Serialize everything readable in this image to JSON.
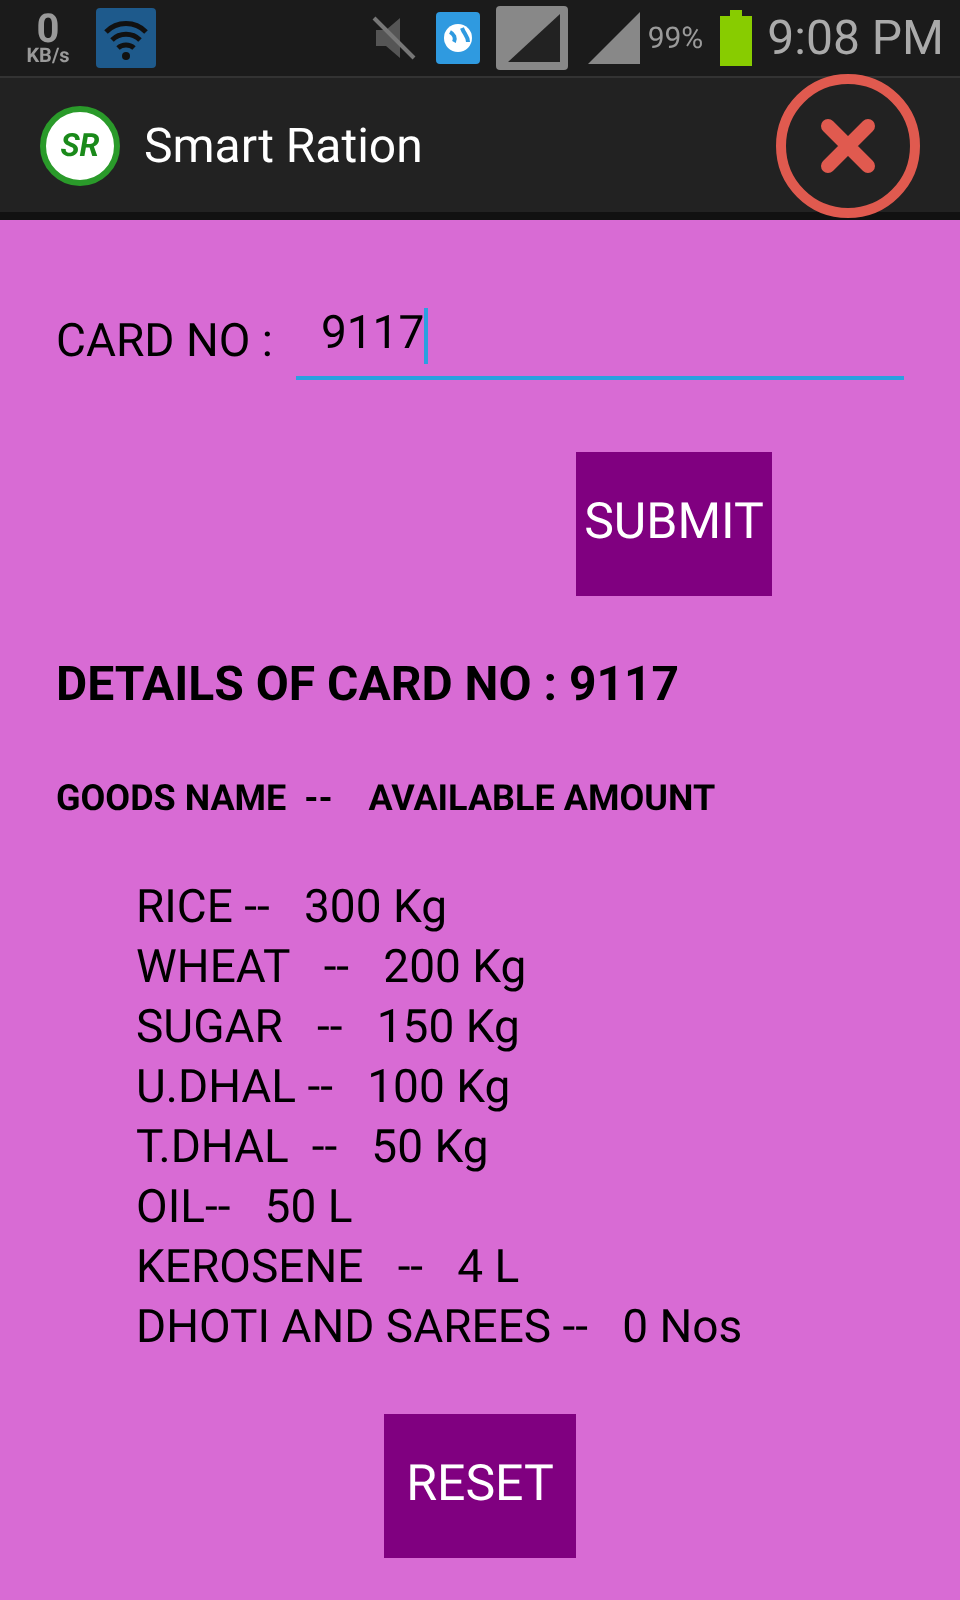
{
  "status_bar": {
    "data_rate": "0",
    "data_unit": "KB/s",
    "battery": "99%",
    "time": "9:08 PM"
  },
  "action_bar": {
    "logo_text": "SR",
    "title": "Smart Ration"
  },
  "card_field": {
    "label": "CARD NO :",
    "value": "9117"
  },
  "submit_button": "SUBMIT",
  "details_heading": "DETAILS OF CARD NO : 9117",
  "list_header": "GOODS NAME  --    AVAILABLE AMOUNT",
  "goods": [
    "RICE --   300 Kg",
    "WHEAT   --   200 Kg",
    "SUGAR   --   150 Kg",
    "U.DHAL --   100 Kg",
    "T.DHAL  --   50 Kg",
    "OIL--   50 L",
    "KEROSENE   --   4 L",
    "DHOTI AND SAREES --   0 Nos"
  ],
  "reset_button": "RESET"
}
